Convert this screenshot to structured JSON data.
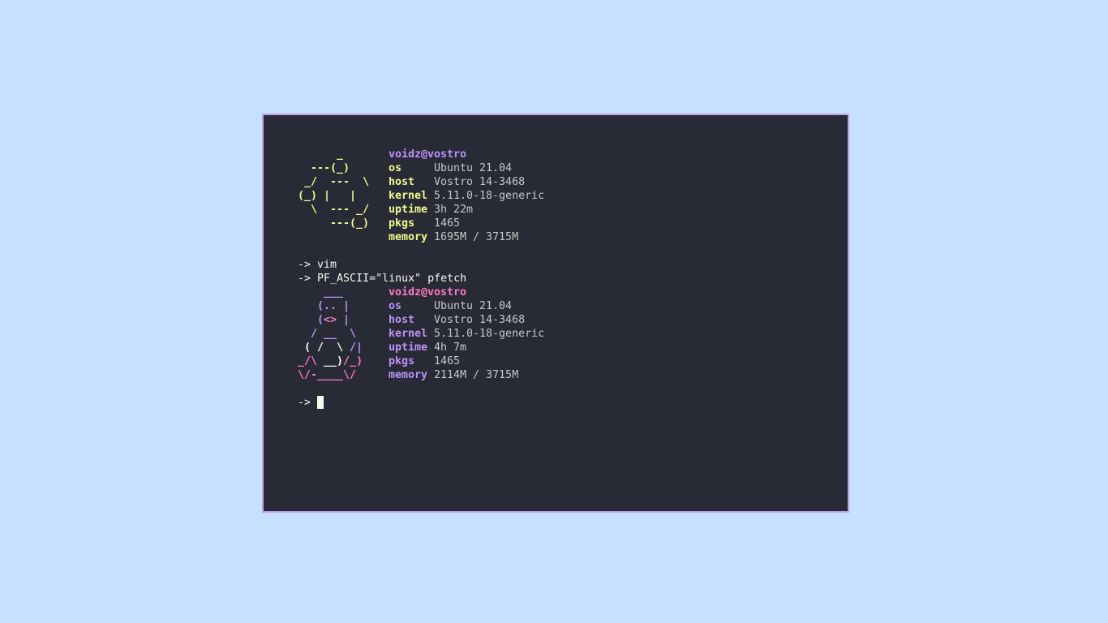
{
  "colors": {
    "background": "#c6e0ff",
    "terminal_bg": "#282a36",
    "terminal_border": "#c39bf0",
    "yellow": "#f1fa8c",
    "purple": "#bd93f9",
    "pink": "#ff79c6"
  },
  "fetch1": {
    "ascii": [
      "      _ ",
      "  ---(_)",
      " _/  ---  \\",
      "(_) |   |",
      "  \\  --- _/",
      "     ---(_)",
      ""
    ],
    "title": "voidz@vostro",
    "rows": [
      {
        "key": "os",
        "value": "Ubuntu 21.04"
      },
      {
        "key": "host",
        "value": "Vostro 14-3468"
      },
      {
        "key": "kernel",
        "value": "5.11.0-18-generic"
      },
      {
        "key": "uptime",
        "value": "3h 22m"
      },
      {
        "key": "pkgs",
        "value": "1465"
      },
      {
        "key": "memory",
        "value": "1695M / 3715M"
      }
    ]
  },
  "commands": [
    {
      "prompt": "->",
      "text": "vim"
    },
    {
      "prompt": "->",
      "text": "PF_ASCII=\"linux\" pfetch"
    }
  ],
  "fetch2": {
    "ascii": [
      "    ___",
      "   (.. |",
      "   (<> |",
      "  / __  \\",
      " ( /  \\ /|",
      "_/\\ __)/_)",
      "\\/-____\\/"
    ],
    "title": "voidz@vostro",
    "rows": [
      {
        "key": "os",
        "value": "Ubuntu 21.04"
      },
      {
        "key": "host",
        "value": "Vostro 14-3468"
      },
      {
        "key": "kernel",
        "value": "5.11.0-18-generic"
      },
      {
        "key": "uptime",
        "value": "4h 7m"
      },
      {
        "key": "pkgs",
        "value": "1465"
      },
      {
        "key": "memory",
        "value": "2114M / 3715M"
      }
    ]
  },
  "final_prompt": "->"
}
